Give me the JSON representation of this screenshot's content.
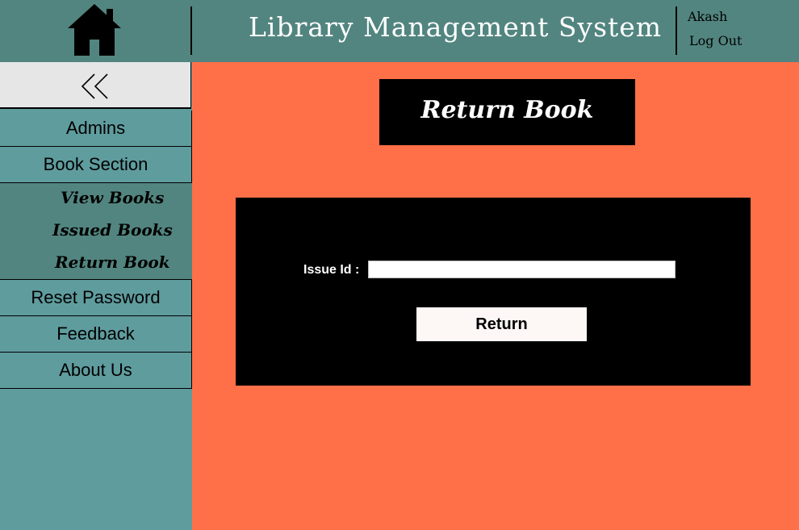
{
  "header": {
    "title": "Library Management System",
    "user_name": "Akash",
    "logout_label": "Log Out",
    "home_icon": "home-icon"
  },
  "sidebar": {
    "collapse_icon": "double-chevron-left-icon",
    "items": [
      {
        "label": "Admins"
      },
      {
        "label": "Book Section"
      },
      {
        "label": "Reset Password"
      },
      {
        "label": "Feedback"
      },
      {
        "label": "About Us"
      }
    ],
    "book_subitems": [
      {
        "label": "View Books"
      },
      {
        "label": "Issued Books"
      },
      {
        "label": "Return Book"
      }
    ]
  },
  "main": {
    "page_title": "Return Book",
    "issue_label": "Issue Id :",
    "issue_value": "",
    "return_label": "Return"
  },
  "colors": {
    "header_bg": "#528580",
    "sidebar_bg": "#5f9c9e",
    "submenu_bg": "#528580",
    "content_bg": "#ff7049",
    "panel_bg": "#000000",
    "button_bg": "#fdf7f6"
  }
}
